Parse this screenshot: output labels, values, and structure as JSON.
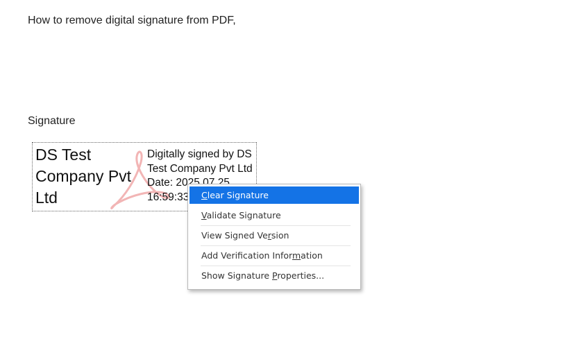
{
  "document": {
    "heading": "How to remove digital signature from PDF,",
    "signature_label": "Signature"
  },
  "signature": {
    "name_lines": [
      "DS Test",
      "Company Pvt",
      "Ltd"
    ],
    "detail_lines": [
      "Digitally signed by DS",
      "Test Company Pvt Ltd",
      "Date: 2025.07.25",
      "16:59:33"
    ],
    "watermark_color": "#f2b5b5"
  },
  "context_menu": {
    "selected_color": "#1473e6",
    "items": [
      {
        "pre": "",
        "key": "C",
        "post": "lear Signature"
      },
      {
        "pre": "",
        "key": "V",
        "post": "alidate Signature"
      },
      {
        "pre": "View Signed Ve",
        "key": "r",
        "post": "sion"
      },
      {
        "pre": "Add Verification Infor",
        "key": "m",
        "post": "ation"
      },
      {
        "pre": "Show Signature ",
        "key": "P",
        "post": "roperties..."
      }
    ]
  }
}
